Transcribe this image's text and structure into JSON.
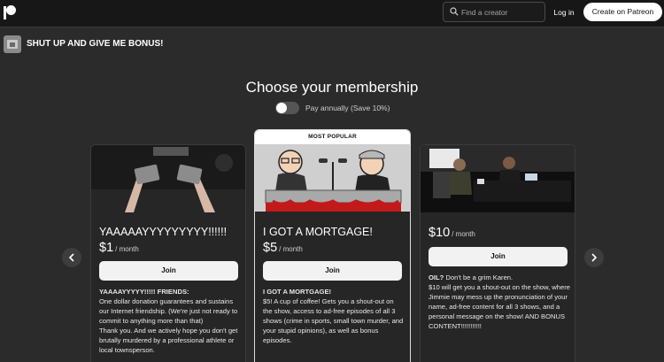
{
  "nav": {
    "logo_icon": "patreon-logo-icon",
    "search_icon": "search-icon",
    "search_placeholder": "Find a creator",
    "login_label": "Log in",
    "create_label": "Create on Patreon"
  },
  "creator": {
    "name": "SHUT UP AND GIVE ME BONUS!"
  },
  "membership": {
    "title": "Choose your membership",
    "annual_toggle_label": "Pay annually (Save 10%)",
    "annual_toggle_on": false
  },
  "carousel": {
    "prev_icon": "chevron-left-icon",
    "next_icon": "chevron-right-icon"
  },
  "tiers": [
    {
      "name": "YAAAAAYYYYYYYYY!!!!!!",
      "price": "$1",
      "period": "/ month",
      "join_label": "Join",
      "description": [
        "YAAAAYYYYY!!!!! FRIENDS:",
        "One dollar donation guarantees and sustains our Internet friendship. (We're just not ready to commit to anything more than that)",
        "Thank you.  And we actively hope you don't get brutally murdered by a professional athlete or local townsperson."
      ]
    },
    {
      "badge": "MOST POPULAR",
      "name": "I GOT A MORTGAGE!",
      "price": "$5",
      "period": "/ month",
      "join_label": "Join",
      "description": [
        "I GOT A MORTGAGE!",
        "$5! A cup of coffee! Gets you a shout-out on the show, access to ad-free episodes of all 3 shows (crime in sports, small town murder, and your stupid opinions), as well as bonus episodes."
      ]
    },
    {
      "price": "$10",
      "period": "/ month",
      "join_label": "Join",
      "description": [
        "OIL?",
        " Don't be a grim Karen.",
        "$10 will get you a shout-out on the show, where Jimmie may mess up the pronunciation of your name, ad-free content for all 3 shows, and a personal message on the show!  AND BONUS CONTENT!!!!!!!!!!!"
      ]
    }
  ],
  "colors": {
    "background": "#2b2b2b",
    "nav_background": "#171717",
    "card_background": "#262626",
    "button": "#f2f2f2"
  }
}
